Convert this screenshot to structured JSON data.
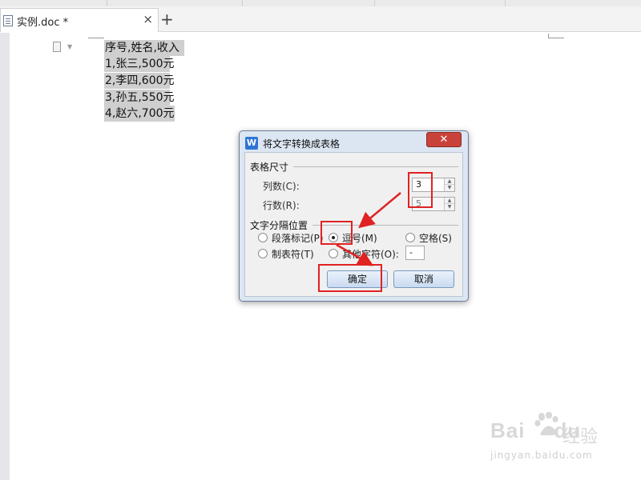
{
  "tab": {
    "title": "实例.doc *",
    "close": "×",
    "new": "+"
  },
  "document": {
    "lines": [
      "序号,姓名,收入",
      "1,张三,500元",
      "2,李四,600元",
      "3,孙五,550元",
      "4,赵六,700元"
    ]
  },
  "dialog": {
    "title": "将文字转换成表格",
    "close": "✕",
    "size_group": "表格尺寸",
    "columns_label": "列数(C):",
    "columns_value": "3",
    "rows_label": "行数(R):",
    "rows_value": "5",
    "sep_group": "文字分隔位置",
    "options": [
      "段落标记(P)",
      "逗号(M)",
      "空格(S)",
      "制表符(T)",
      "其他字符(O):"
    ],
    "selected_option": "逗号(M)",
    "other_char": "-",
    "ok": "确定",
    "cancel": "取消"
  },
  "watermark": {
    "brand": "Bai",
    "brand2": "du",
    "product": "经验",
    "url": "jingyan.baidu.com"
  },
  "colors": {
    "highlight": "#e02222",
    "selection": "#cfcfcf",
    "dialog_frame": "#dce6f2"
  }
}
